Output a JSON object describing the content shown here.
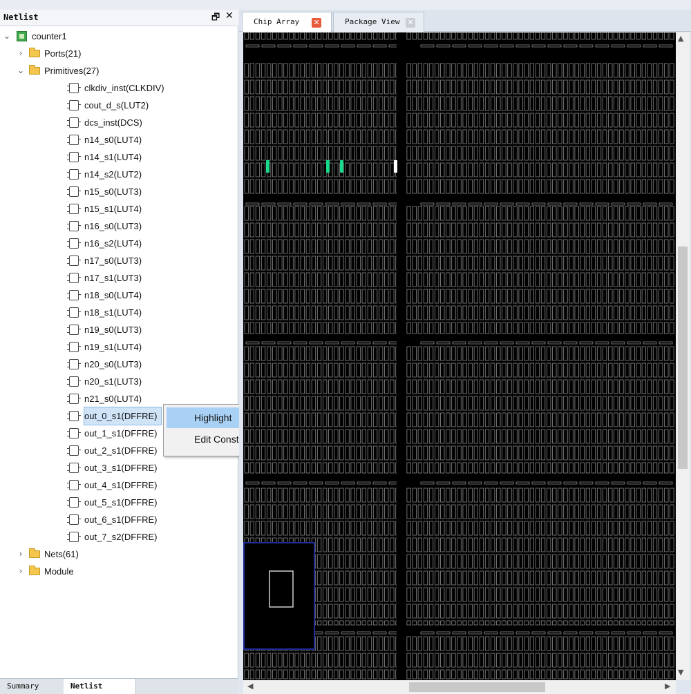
{
  "netlist_panel": {
    "title": "Netlist",
    "float_icon": "float-window-icon",
    "close_icon": "close-icon",
    "tree": {
      "root": "counter1",
      "ports": "Ports(21)",
      "primitives": "Primitives(27)",
      "primitive_items": [
        "clkdiv_inst(CLKDIV)",
        "cout_d_s(LUT2)",
        "dcs_inst(DCS)",
        "n14_s0(LUT4)",
        "n14_s1(LUT4)",
        "n14_s2(LUT2)",
        "n15_s0(LUT3)",
        "n15_s1(LUT4)",
        "n16_s0(LUT3)",
        "n16_s2(LUT4)",
        "n17_s0(LUT3)",
        "n17_s1(LUT3)",
        "n18_s0(LUT4)",
        "n18_s1(LUT4)",
        "n19_s0(LUT3)",
        "n19_s1(LUT4)",
        "n20_s0(LUT3)",
        "n20_s1(LUT3)",
        "n21_s0(LUT4)",
        "out_0_s1(DFFRE)",
        "out_1_s1(DFFRE)",
        "out_2_s1(DFFRE)",
        "out_3_s1(DFFRE)",
        "out_4_s1(DFFRE)",
        "out_5_s1(DFFRE)",
        "out_6_s1(DFFRE)",
        "out_7_s2(DFFRE)"
      ],
      "selected_item": "out_0_s1(DFFRE)",
      "nets": "Nets(61)",
      "module": "Module"
    },
    "context_menu": {
      "highlight": "Highlight",
      "edit_constraint": "Edit Constraint"
    },
    "bottom_tabs": {
      "summary": "Summary",
      "netlist": "Netlist",
      "active": "Netlist"
    }
  },
  "editor": {
    "tabs": [
      {
        "label": "Chip Array",
        "active": true
      },
      {
        "label": "Package View",
        "active": false
      }
    ],
    "colors": {
      "background": "#000000",
      "cell_outline": "#8a8a8a",
      "placed_cell": "#19d98a",
      "highlighted_cell": "#ffffff",
      "io_block_border": "#1f2a9a"
    }
  }
}
